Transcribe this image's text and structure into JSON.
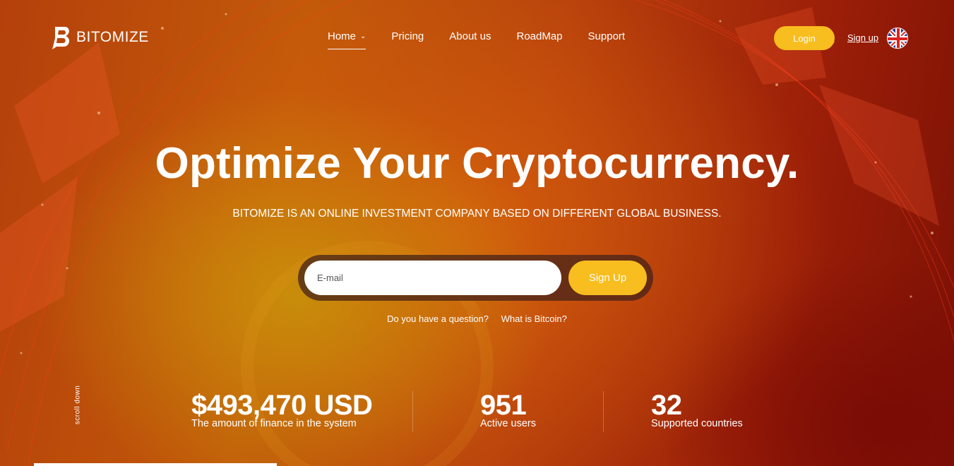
{
  "brand": {
    "name": "BITOMIZE",
    "accent": "#f8bd1e"
  },
  "nav": {
    "items": [
      {
        "label": "Home",
        "active": true,
        "dropdown": true
      },
      {
        "label": "Pricing"
      },
      {
        "label": "About us"
      },
      {
        "label": "RoadMap"
      },
      {
        "label": "Support"
      }
    ],
    "login_label": "Login",
    "signup_label": "Sign up",
    "language_flag": "uk-flag-icon"
  },
  "hero": {
    "title": "Optimize Your Cryptocurrency.",
    "subtitle": "BITOMIZE IS AN ONLINE INVESTMENT COMPANY BASED ON DIFFERENT GLOBAL BUSINESS.",
    "email_placeholder": "E-mail",
    "signup_button": "Sign Up",
    "links": [
      "Do you have a question?",
      "What is Bitcoin?"
    ]
  },
  "scroll_label": "scroll down",
  "stats": [
    {
      "value": "$493,470 USD",
      "label": "The amount of finance in the system"
    },
    {
      "value": "951",
      "label": "Active users"
    },
    {
      "value": "32",
      "label": "Supported countries"
    }
  ]
}
